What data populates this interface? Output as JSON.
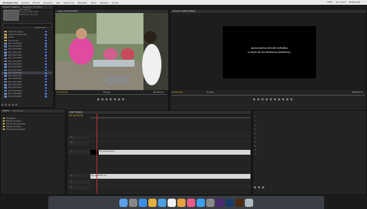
{
  "menubar": {
    "app": "Premiere Pro",
    "items": [
      "Archivo",
      "Edición",
      "Proyecto",
      "Clip",
      "Secuencia",
      "Marcador",
      "Título",
      "Ventana",
      "Ayuda"
    ],
    "right": [
      "100%",
      "Lun 19:47",
      "Multimedia",
      ""
    ]
  },
  "project_panel": {
    "tabs": [
      "Proyecto: Sesión 4",
      "Navegador de medios"
    ],
    "info_lines": [
      "NIÑO TRABAJO",
      "Secuencia, 1920 x 1080",
      "00;00;44;19, 29,97 fps"
    ],
    "item_count": "44 elementos",
    "items": [
      {
        "name": "Videos de apoyo",
        "type": "folder"
      },
      {
        "name": "Videos de entrevista",
        "type": "folder"
      },
      {
        "name": "Títulos",
        "type": "folder"
      },
      {
        "name": "Secuencias",
        "type": "folder"
      },
      {
        "name": "MVI_0118.MOV",
        "type": "clip"
      },
      {
        "name": "MVI_0119.MOV",
        "type": "clip"
      },
      {
        "name": "MVI_0120.MOV",
        "type": "clip"
      },
      {
        "name": "MVI_0121.MOV",
        "type": "clip"
      },
      {
        "name": "MVI_0122.MOV",
        "type": "clip"
      },
      {
        "name": "MVI_0123.MOV",
        "type": "clip"
      },
      {
        "name": "MVI_0124.MOV",
        "type": "clip"
      },
      {
        "name": "MVI_0125.MOV",
        "type": "clip"
      },
      {
        "name": "MVI_0126.MOV",
        "type": "clip"
      },
      {
        "name": "MVI_0127.MOV",
        "type": "clip"
      },
      {
        "name": "MVI_0128.MOV",
        "type": "clip",
        "selected": true
      },
      {
        "name": "MVI_0129.MOV",
        "type": "clip"
      },
      {
        "name": "MVI_0130.MOV",
        "type": "clip"
      },
      {
        "name": "MVI_0131.MOV",
        "type": "clip"
      },
      {
        "name": "MVI_0132.MOV",
        "type": "clip"
      },
      {
        "name": "MVI_0133.MOV",
        "type": "clip"
      },
      {
        "name": "MVI_0134.MOV",
        "type": "clip"
      },
      {
        "name": "MVI_0135.MOV",
        "type": "clip"
      },
      {
        "name": "MVI_0136.MOV",
        "type": "clip"
      }
    ]
  },
  "source_monitor": {
    "tab": "Origen: MVI_0128.MOV",
    "timecode_in": "00:00:00:00",
    "fit": "Encajar",
    "timecode_out": "00:00:26:12"
  },
  "program_monitor": {
    "tab": "Programa: NIÑO TRABAJO",
    "title_line1": "Autoconstrucción del individuo",
    "title_line2": "a través de las dinámicas familiares.",
    "timecode_in": "00:00:00:00",
    "fit": "Encajar",
    "timecode_out": "00:00:44:19"
  },
  "effects_panel": {
    "tabs": [
      "Efectos",
      "Marcadores"
    ],
    "items": [
      "Preajustes",
      "Efectos de audio",
      "Transiciones de audio",
      "Efectos de vídeo",
      "Transiciones de vídeo"
    ]
  },
  "timeline": {
    "tab": "NIÑO TRABAJO",
    "timecode": "00:00:00:00",
    "video_tracks": [
      "V3",
      "V2",
      "V1"
    ],
    "audio_tracks": [
      "A1",
      "A2",
      "A3"
    ],
    "video_clip_label": "MVI_0128.MOV [V]",
    "audio_clip_label": "MVI_0128.MOV [A]"
  },
  "meters": {
    "scale": [
      "0",
      "-6",
      "-12",
      "-18",
      "-24",
      "-30",
      "-36",
      "-42",
      "-48",
      "-54"
    ]
  },
  "colors": {
    "timecode": "#e1b830",
    "label_blue": "#4c6fd0",
    "folder": "#c9a85a"
  },
  "dock_icons": [
    "finder-icon",
    "launchpad-icon",
    "safari-icon",
    "chrome-icon",
    "mail-icon",
    "calendar-icon",
    "photos-icon",
    "itunes-icon",
    "app-store-icon",
    "preferences-icon",
    "premiere-icon",
    "photoshop-icon",
    "illustrator-icon",
    "trash-icon"
  ]
}
